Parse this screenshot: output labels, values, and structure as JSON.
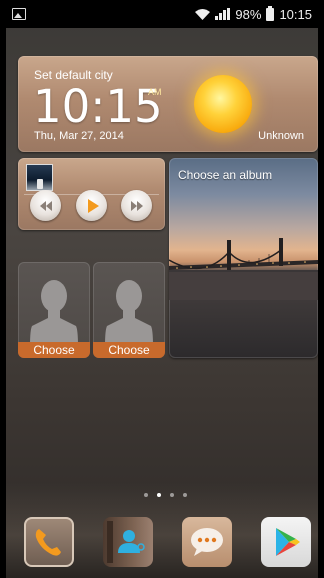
{
  "status_bar": {
    "battery_percent": "98%",
    "time": "10:15",
    "icons": [
      "image-icon",
      "wifi-icon",
      "signal-icon",
      "battery-icon"
    ]
  },
  "clock_widget": {
    "city_prompt": "Set default city",
    "time": "10:15",
    "ampm": "AM",
    "date": "Thu, Mar 27, 2014",
    "weather": "Unknown",
    "weather_icon": "sun-icon"
  },
  "music_widget": {
    "album_art_icon": "album-art-icon",
    "controls": [
      "rewind-icon",
      "play-icon",
      "fast-forward-icon"
    ]
  },
  "album_widget": {
    "label": "Choose an album"
  },
  "contacts": [
    {
      "label": "Choose",
      "icon": "person-silhouette-icon"
    },
    {
      "label": "Choose",
      "icon": "person-silhouette-icon"
    }
  ],
  "page_indicator": {
    "total": 4,
    "active": 2
  },
  "dock": [
    {
      "name": "Phone",
      "icon": "phone-icon"
    },
    {
      "name": "Contacts",
      "icon": "contacts-icon"
    },
    {
      "name": "Messaging",
      "icon": "message-icon"
    },
    {
      "name": "Play Store",
      "icon": "play-store-icon"
    }
  ],
  "colors": {
    "accent_orange": "#c86a2c",
    "tile_tan": "#b08a70",
    "play_orange": "#f39a1e"
  }
}
